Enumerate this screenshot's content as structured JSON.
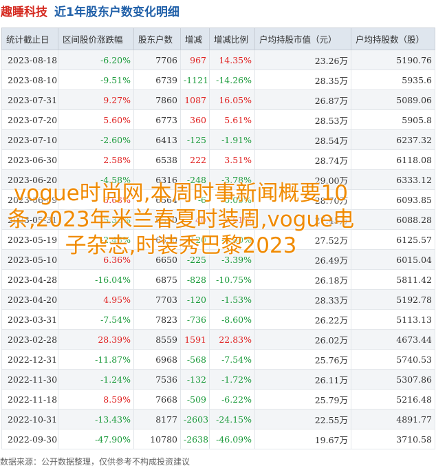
{
  "header": {
    "brand": "趣睡科技",
    "subtitle": "近1年股东户数变化明细"
  },
  "table": {
    "columns": [
      "统计截止日",
      "区间股价涨跌幅",
      "股东户数",
      "增减",
      "增减比例",
      "户均持股市值（元）",
      "户均持股数（股）"
    ],
    "rows": [
      [
        "2023-08-18",
        "-6.20%",
        "7706",
        "967",
        "14.35%",
        "23.26万",
        "5190.76"
      ],
      [
        "2023-08-10",
        "-9.51%",
        "6739",
        "-1121",
        "-14.26%",
        "28.35万",
        "5935.6"
      ],
      [
        "2023-07-31",
        "9.27%",
        "7860",
        "1087",
        "16.05%",
        "26.87万",
        "5089.06"
      ],
      [
        "2023-07-20",
        "5.60%",
        "6773",
        "360",
        "5.61%",
        "28.53万",
        "5905.8"
      ],
      [
        "2023-07-10",
        "-2.60%",
        "6413",
        "-125",
        "-1.91%",
        "28.54万",
        "6237.32"
      ],
      [
        "2023-06-30",
        "2.58%",
        "6538",
        "222",
        "3.51%",
        "28.74万",
        "6118.08"
      ],
      [
        "2023-06-20",
        "-4.58%",
        "6316",
        "-248",
        "-3.78%",
        "29.00万",
        "6333.12"
      ],
      [
        "2023-06-09",
        "5.63%",
        "6564",
        "-6",
        "-0.09%",
        "28.70万",
        "6093.85"
      ],
      [
        "2023-05-31",
        "-5.35%",
        "6570",
        "40",
        "0.61%",
        "27.45万",
        "6088.28"
      ],
      [
        "2023-05-19",
        "-2.45%",
        "6530",
        "-120",
        "-1.80%",
        "27.52万",
        "6125.57"
      ],
      [
        "2023-05-10",
        "6.36%",
        "6650",
        "-225",
        "-3.39%",
        "26.49万",
        "6015.04"
      ],
      [
        "2023-04-28",
        "-16.04%",
        "6875",
        "-828",
        "-10.75%",
        "26.18万",
        "5811.42"
      ],
      [
        "2023-04-20",
        "4.95%",
        "7703",
        "-120",
        "-1.53%",
        "28.33万",
        "5192.78"
      ],
      [
        "2023-03-31",
        "-7.54%",
        "7823",
        "-736",
        "-8.60%",
        "26.22万",
        "5113.13"
      ],
      [
        "2023-02-28",
        "28.39%",
        "8559",
        "1591",
        "22.83%",
        "26.02万",
        "4673.44"
      ],
      [
        "2022-12-31",
        "-11.87%",
        "6968",
        "-568",
        "-7.54%",
        "25.76万",
        "5740.53"
      ],
      [
        "2022-11-30",
        "-1.24%",
        "7536",
        "-132",
        "-1.72%",
        "26.11万",
        "5307.86"
      ],
      [
        "2022-11-18",
        "8.59%",
        "7668",
        "-509",
        "-6.22%",
        "25.79万",
        "5216.48"
      ],
      [
        "2022-10-31",
        "-13.43%",
        "8177",
        "-2603",
        "-24.15%",
        "22.55万",
        "4891.77"
      ],
      [
        "2022-09-30",
        "-47.90%",
        "10780",
        "-2638",
        "-46.09%",
        "19.67万",
        "3710.58"
      ]
    ]
  },
  "overlay": {
    "text": "vogue时尚网,本周时事新闻概要10条,2023年米兰春夏时装周,vogue电子杂志,时装秀巴黎2023"
  },
  "footer": {
    "source": "数据来源：公开数据整理，仅供参考不构成投资建议"
  },
  "colors": {
    "positive": "#e02020",
    "negative": "#1a9a3a",
    "brand": "#d52a20",
    "title": "#1f5fa8",
    "overlay": "#f08a00"
  }
}
